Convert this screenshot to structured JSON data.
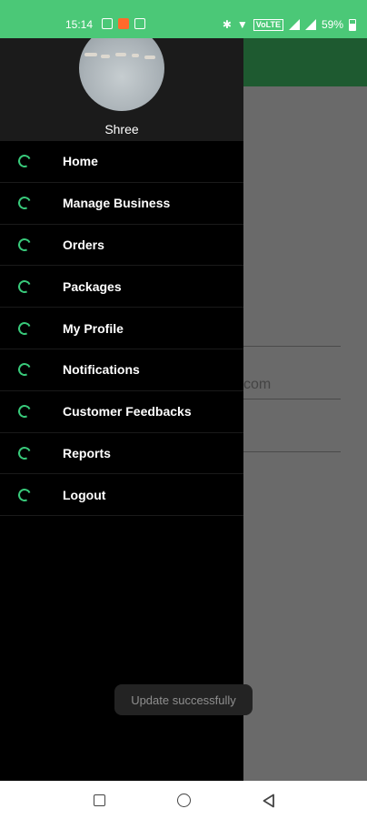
{
  "status_bar": {
    "time": "15:14",
    "lte": "VoLTE",
    "battery": "59%"
  },
  "drawer": {
    "user_name": "Shree",
    "items": [
      {
        "label": "Home",
        "icon": "loader-ring-icon"
      },
      {
        "label": "Manage Business",
        "icon": "loader-ring-icon"
      },
      {
        "label": "Orders",
        "icon": "loader-ring-icon"
      },
      {
        "label": "Packages",
        "icon": "loader-ring-icon"
      },
      {
        "label": "My Profile",
        "icon": "loader-ring-icon"
      },
      {
        "label": "Notifications",
        "icon": "loader-ring-icon"
      },
      {
        "label": "Customer Feedbacks",
        "icon": "loader-ring-icon"
      },
      {
        "label": "Reports",
        "icon": "loader-ring-icon"
      },
      {
        "label": "Logout",
        "icon": "loader-ring-icon"
      }
    ]
  },
  "background": {
    "email_fragment": "com"
  },
  "toast": {
    "message": "Update successfully"
  },
  "colors": {
    "accent": "#4bc877",
    "toolbar": "#1e5a30",
    "icon": "#38c97a"
  }
}
